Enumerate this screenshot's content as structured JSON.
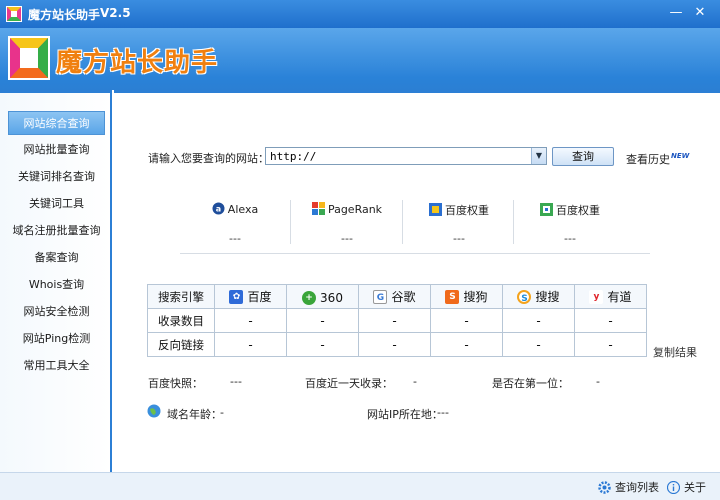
{
  "window": {
    "title": "魔方站长助手",
    "version": "V2.5",
    "min_glyph": "—",
    "close_glyph": "✕"
  },
  "header": {
    "logo_text": "魔方站长助手"
  },
  "sidebar": {
    "items": [
      {
        "label": "网站综合查询",
        "active": true
      },
      {
        "label": "网站批量查询"
      },
      {
        "label": "关键词排名查询"
      },
      {
        "label": "关键词工具"
      },
      {
        "label": "域名注册批量查询"
      },
      {
        "label": "备案查询"
      },
      {
        "label": "Whois查询"
      },
      {
        "label": "网站安全检测"
      },
      {
        "label": "网站Ping检测"
      },
      {
        "label": "常用工具大全"
      }
    ]
  },
  "search": {
    "label": "请输入您要查询的网站：",
    "value": "http://",
    "button": "查询",
    "history": "查看历史",
    "new_badge": "NEW"
  },
  "ranks": [
    {
      "name": "Alexa",
      "value": "---",
      "icon": "alexa-icon"
    },
    {
      "name": "PageRank",
      "value": "---",
      "icon": "pagerank-icon"
    },
    {
      "name": "百度权重",
      "value": "---",
      "icon": "baidu-weight-icon"
    },
    {
      "name": "百度权重",
      "value": "---",
      "icon": "baidu-weight-alt-icon"
    }
  ],
  "table": {
    "row_headers": [
      "搜索引擎",
      "收录数目",
      "反向链接"
    ],
    "engines": [
      {
        "name": "百度",
        "icon": "baidu-icon",
        "color": "#2f6bd8",
        "glyph": "🐾"
      },
      {
        "name": "360",
        "icon": "360-icon",
        "color": "#3aa53a",
        "glyph": "+"
      },
      {
        "name": "谷歌",
        "icon": "google-icon",
        "color": "#ffffff",
        "glyph": "G"
      },
      {
        "name": "搜狗",
        "icon": "sogou-icon",
        "color": "#f06a1b",
        "glyph": "S"
      },
      {
        "name": "搜搜",
        "icon": "soso-icon",
        "color": "#ffffff",
        "glyph": "S"
      },
      {
        "name": "有道",
        "icon": "youdao-icon",
        "color": "#ffffff",
        "glyph": "y"
      }
    ],
    "indexed": [
      "-",
      "-",
      "-",
      "-",
      "-",
      "-"
    ],
    "backlinks": [
      "-",
      "-",
      "-",
      "-",
      "-",
      "-"
    ],
    "copy_label": "复制结果"
  },
  "info": {
    "baidu_snapshot_label": "百度快照：",
    "baidu_snapshot_value": "---",
    "baidu_day_label": "百度近一天收录：",
    "baidu_day_value": "-",
    "first_label": "是否在第一位：",
    "first_value": "-",
    "domain_age_label": "域名年龄：",
    "domain_age_value": "-",
    "ip_location_label": "网站IP所在地：",
    "ip_location_value": "---"
  },
  "statusbar": {
    "query_list": "查询列表",
    "about": "关于"
  }
}
